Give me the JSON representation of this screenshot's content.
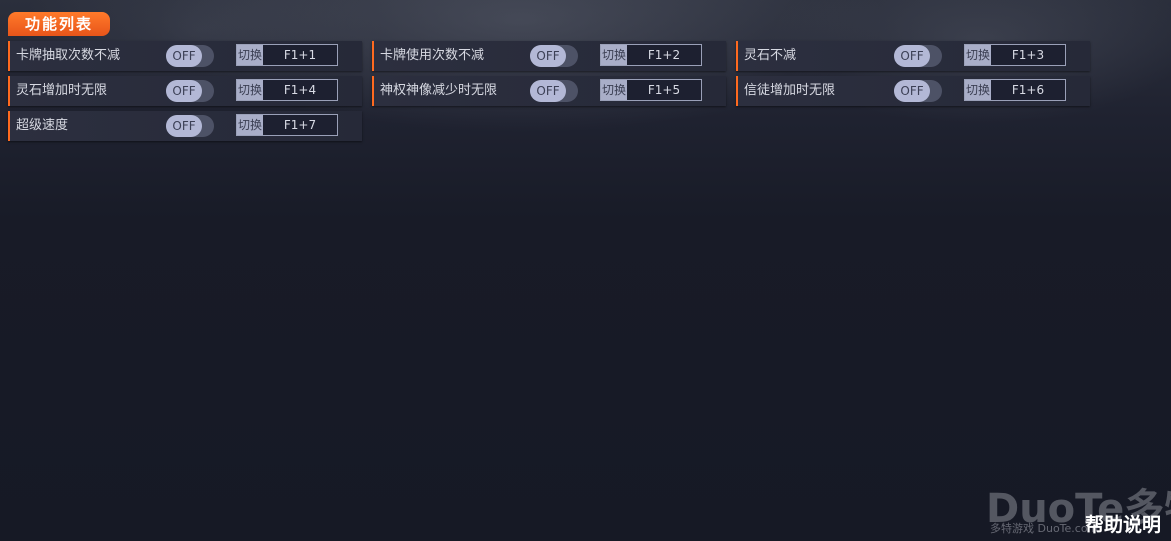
{
  "header": {
    "title": "功能列表"
  },
  "features": [
    {
      "label": "卡牌抽取次数不减",
      "state": "OFF",
      "toggle_label": "切换",
      "hotkey": "F1+1"
    },
    {
      "label": "卡牌使用次数不减",
      "state": "OFF",
      "toggle_label": "切换",
      "hotkey": "F1+2"
    },
    {
      "label": "灵石不减",
      "state": "OFF",
      "toggle_label": "切换",
      "hotkey": "F1+3"
    },
    {
      "label": "灵石增加时无限",
      "state": "OFF",
      "toggle_label": "切换",
      "hotkey": "F1+4"
    },
    {
      "label": "神权神像减少时无限",
      "state": "OFF",
      "toggle_label": "切换",
      "hotkey": "F1+5"
    },
    {
      "label": "信徒增加时无限",
      "state": "OFF",
      "toggle_label": "切换",
      "hotkey": "F1+6"
    },
    {
      "label": "超级速度",
      "state": "OFF",
      "toggle_label": "切换",
      "hotkey": "F1+7"
    }
  ],
  "watermark": {
    "brand": "DuoTe多特",
    "sub": "多特游戏 DuoTe.com"
  },
  "footer": {
    "help": "帮助说明"
  },
  "colors": {
    "accent": "#ff6a1f",
    "toggle_off": "#b3b8d6"
  }
}
